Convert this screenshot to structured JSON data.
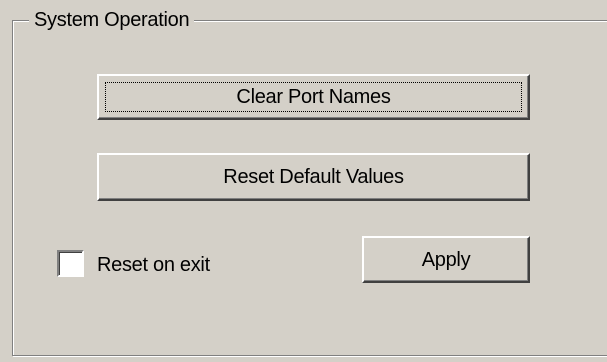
{
  "group": {
    "title": "System Operation"
  },
  "buttons": {
    "clear_port_names": "Clear Port Names",
    "reset_default_values": "Reset Default Values",
    "apply": "Apply"
  },
  "reset_on_exit": {
    "label": "Reset on exit",
    "checked": false
  },
  "colors": {
    "dialog_face": "#d4d0c8",
    "shadow": "#808080",
    "highlight": "#ffffff"
  }
}
